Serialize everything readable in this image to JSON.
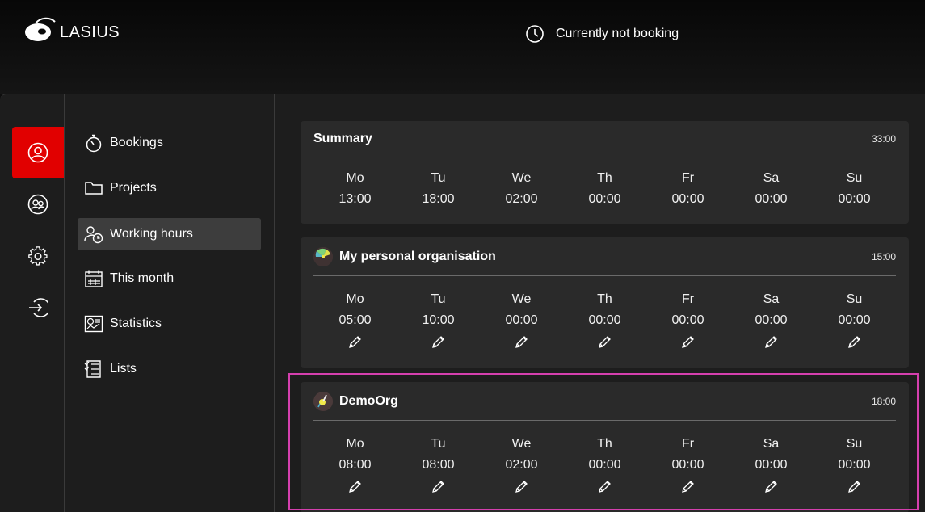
{
  "app": {
    "logo_text": "LASIUS"
  },
  "header": {
    "booking_status": "Currently not booking"
  },
  "nav": {
    "items": [
      {
        "label": "Bookings",
        "icon": "stopwatch-icon"
      },
      {
        "label": "Projects",
        "icon": "folder-icon"
      },
      {
        "label": "Working hours",
        "icon": "user-clock-icon",
        "active": true
      },
      {
        "label": "This month",
        "icon": "calendar-icon"
      },
      {
        "label": "Statistics",
        "icon": "chart-report-icon"
      },
      {
        "label": "Lists",
        "icon": "list-icon"
      }
    ]
  },
  "rail": {
    "items": [
      "user-circle-icon",
      "users-icon",
      "gear-icon",
      "logout-icon"
    ]
  },
  "summary": {
    "title": "Summary",
    "total": "33:00",
    "days": [
      {
        "label": "Mo",
        "value": "13:00"
      },
      {
        "label": "Tu",
        "value": "18:00"
      },
      {
        "label": "We",
        "value": "02:00"
      },
      {
        "label": "Th",
        "value": "00:00"
      },
      {
        "label": "Fr",
        "value": "00:00"
      },
      {
        "label": "Sa",
        "value": "00:00"
      },
      {
        "label": "Su",
        "value": "00:00"
      }
    ]
  },
  "orgs": [
    {
      "title": "My personal organisation",
      "total": "15:00",
      "days": [
        {
          "label": "Mo",
          "value": "05:00"
        },
        {
          "label": "Tu",
          "value": "10:00"
        },
        {
          "label": "We",
          "value": "00:00"
        },
        {
          "label": "Th",
          "value": "00:00"
        },
        {
          "label": "Fr",
          "value": "00:00"
        },
        {
          "label": "Sa",
          "value": "00:00"
        },
        {
          "label": "Su",
          "value": "00:00"
        }
      ]
    },
    {
      "title": "DemoOrg",
      "total": "18:00",
      "days": [
        {
          "label": "Mo",
          "value": "08:00"
        },
        {
          "label": "Tu",
          "value": "08:00"
        },
        {
          "label": "We",
          "value": "02:00"
        },
        {
          "label": "Th",
          "value": "00:00"
        },
        {
          "label": "Fr",
          "value": "00:00"
        },
        {
          "label": "Sa",
          "value": "00:00"
        },
        {
          "label": "Su",
          "value": "00:00"
        }
      ]
    }
  ],
  "colors": {
    "accent": "#e10000",
    "highlight": "#d43fae"
  }
}
